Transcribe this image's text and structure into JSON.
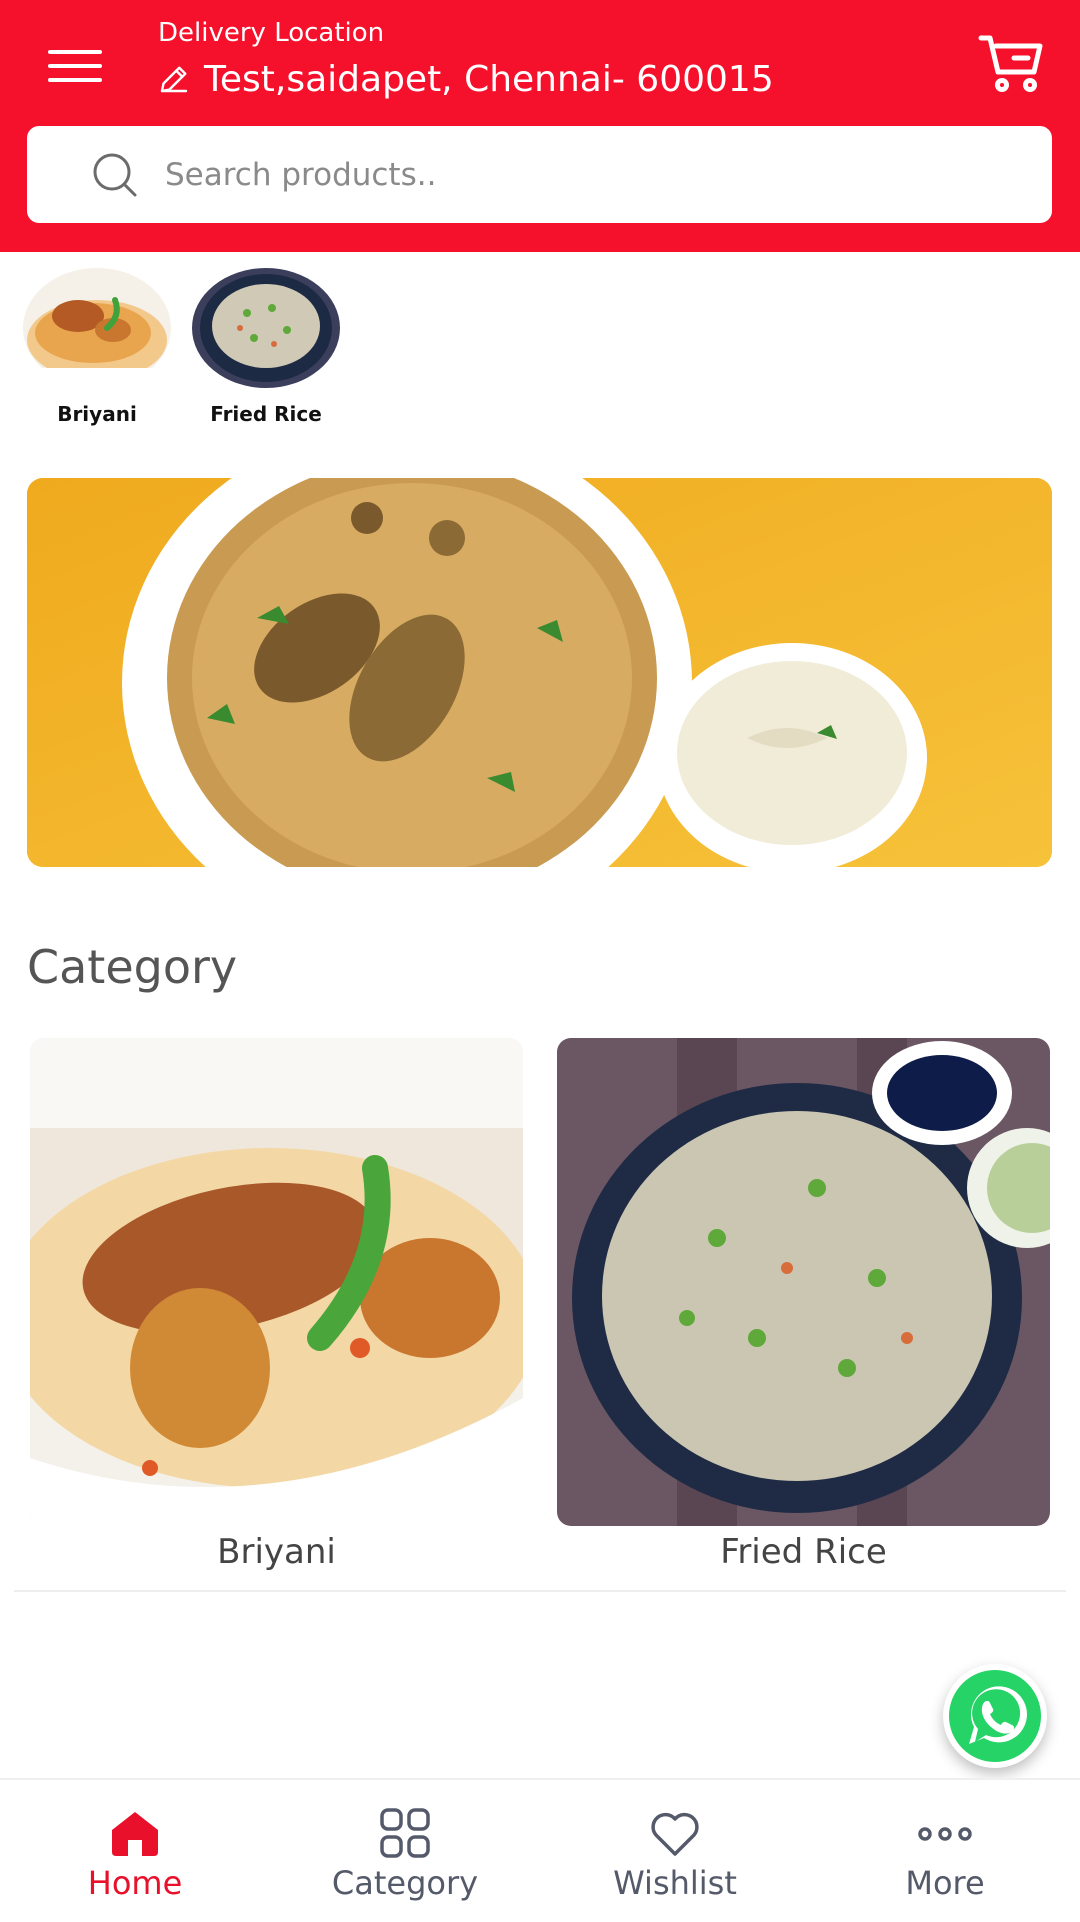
{
  "header": {
    "location_label": "Delivery Location",
    "location_value": "Test,saidapet,  Chennai- 600015",
    "menu_icon": "hamburger-menu-icon",
    "cart_icon": "shopping-cart-icon",
    "color": "#f5112b"
  },
  "search": {
    "placeholder": "Search products..",
    "icon": "search-icon"
  },
  "quick_categories": [
    {
      "label": "Briyani"
    },
    {
      "label": "Fried Rice"
    }
  ],
  "main": {
    "section_title": "Category",
    "cards": [
      {
        "label": "Briyani"
      },
      {
        "label": "Fried Rice"
      }
    ]
  },
  "bottom_nav": {
    "items": [
      {
        "label": "Home",
        "icon": "home-icon",
        "active": true
      },
      {
        "label": "Category",
        "icon": "grid-icon",
        "active": false
      },
      {
        "label": "Wishlist",
        "icon": "heart-icon",
        "active": false
      },
      {
        "label": "More",
        "icon": "more-dots-icon",
        "active": false
      }
    ],
    "active_color": "#e8102a"
  },
  "floating": {
    "icon": "whatsapp-icon"
  }
}
